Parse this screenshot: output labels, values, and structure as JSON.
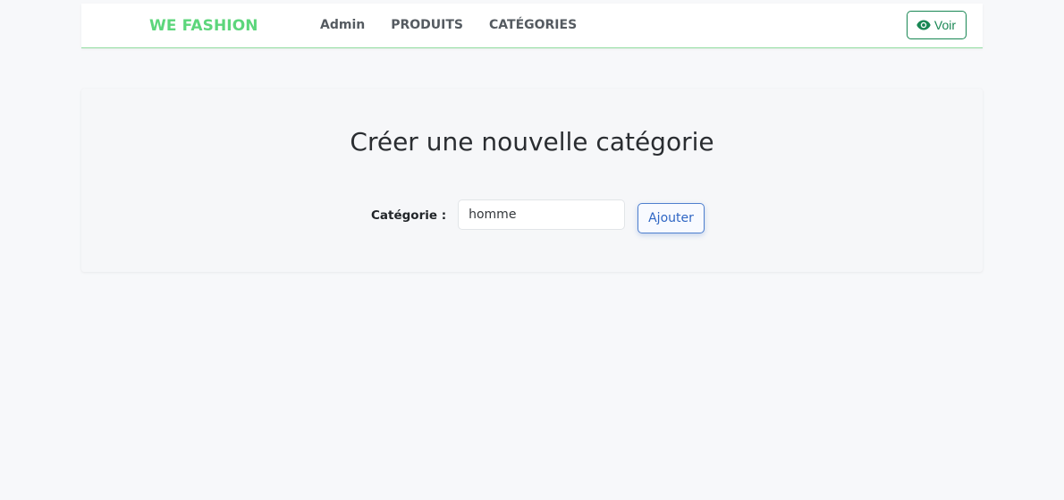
{
  "navbar": {
    "brand": "WE FASHION",
    "links": [
      {
        "label": "Admin"
      },
      {
        "label": "PRODUITS"
      },
      {
        "label": "CATÉGORIES"
      }
    ],
    "voir_button": {
      "label": "Voir",
      "icon": "eye-icon"
    }
  },
  "main": {
    "title": "Créer une nouvelle catégorie",
    "form": {
      "label": "Catégorie :",
      "input_value": "homme",
      "submit_label": "Ajouter"
    }
  },
  "colors": {
    "brand": "#5cd67b",
    "success": "#198754",
    "primary": "#2f66c4",
    "background": "#f7f8fa"
  }
}
